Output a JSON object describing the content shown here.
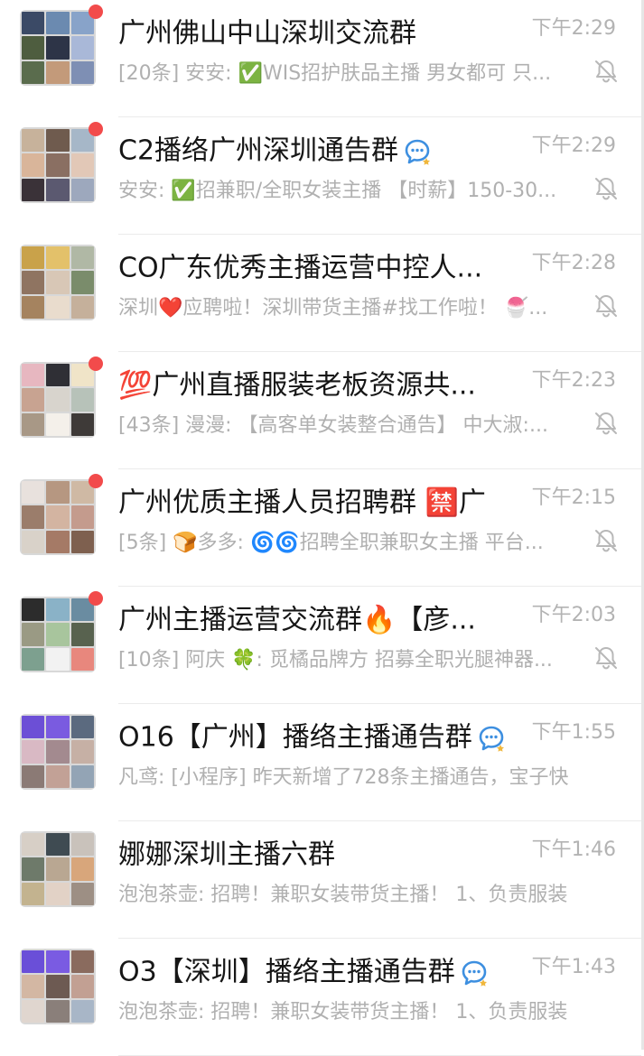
{
  "chats": [
    {
      "title": "广州佛山中山深圳交流群",
      "time": "下午2:29",
      "preview": "[20条] 安安: ✅WIS招护肤品主播 男女都可 只...",
      "unread_dot": true,
      "muted": true,
      "ai_badge": false,
      "tiles": [
        "#3b4a66",
        "#6b8ab0",
        "#88a3c9",
        "#4e5d3f",
        "#2d3447",
        "#a9b8d8",
        "#5a6c4d",
        "#c39a7a",
        "#7e8fb4"
      ]
    },
    {
      "title": "C2播络广州深圳通告群",
      "time": "下午2:29",
      "preview": "安安: ✅招兼职/全职女装主播 【时薪】150-30...",
      "unread_dot": true,
      "muted": true,
      "ai_badge": true,
      "tiles": [
        "#c7b29b",
        "#6f5b4e",
        "#a6b7c8",
        "#d9b59a",
        "#8a6f62",
        "#e2c8b7",
        "#3a3238",
        "#5b5970",
        "#9da8bd"
      ]
    },
    {
      "title": "CO广东优秀主播运营中控人...",
      "time": "下午2:28",
      "preview": "深圳❤️应聘啦！深圳带货主播#找工作啦！ 🍧...",
      "unread_dot": false,
      "muted": true,
      "ai_badge": false,
      "tiles": [
        "#c9a24a",
        "#e3c16a",
        "#b0b8a5",
        "#8f7461",
        "#d8c7b6",
        "#7a8c6b",
        "#a5835f",
        "#e9dccd",
        "#c5b09b"
      ]
    },
    {
      "title": "💯广州直播服装老板资源共...",
      "time": "下午2:23",
      "preview": "[43条] 漫漫: 【高客单女装整合通告】 中大淑:...",
      "unread_dot": true,
      "muted": true,
      "ai_badge": false,
      "tiles": [
        "#e7b7c0",
        "#2f2f35",
        "#f0e4c8",
        "#c8a391",
        "#d8d4cd",
        "#b7c2b9",
        "#a89886",
        "#f4f0ea",
        "#3e3a38"
      ]
    },
    {
      "title": "广州优质主播人员招聘群 🈲广",
      "time": "下午2:15",
      "preview": "[5条] 🍞多多: 🌀🌀招聘全职兼职女主播 平台...",
      "unread_dot": true,
      "muted": true,
      "ai_badge": false,
      "tiles": [
        "#e8e1dd",
        "#b69781",
        "#cfb9a4",
        "#9b7d6b",
        "#d3b4a1",
        "#c49b8d",
        "#d9d2c9",
        "#a57a66",
        "#7e604f"
      ]
    },
    {
      "title": "广州主播运营交流群🔥【彦...",
      "time": "下午2:03",
      "preview": "[10条] 阿庆 🍀: 觅橘品牌方 招募全职光腿神器...",
      "unread_dot": true,
      "muted": true,
      "ai_badge": false,
      "tiles": [
        "#2c2c2c",
        "#8ab2c7",
        "#6a8ca1",
        "#9a9a84",
        "#a8c59d",
        "#58624f",
        "#7da08f",
        "#f2f2f2",
        "#e8877d"
      ]
    },
    {
      "title": "O16【广州】播络主播通告群",
      "time": "下午1:55",
      "preview": "凡鸢: [小程序] 昨天新增了728条主播通告，宝子快...",
      "unread_dot": false,
      "muted": false,
      "ai_badge": true,
      "tiles": [
        "#6c4fd6",
        "#7a5be0",
        "#5b6a7f",
        "#d9b9c4",
        "#a38a8f",
        "#c6b0a5",
        "#8b7a75",
        "#c2a196",
        "#93a4b5"
      ]
    },
    {
      "title": "娜娜深圳主播六群",
      "time": "下午1:46",
      "preview": "泡泡茶壶: 招聘！兼职女装带货主播！ 1、负责服装...",
      "unread_dot": false,
      "muted": false,
      "ai_badge": false,
      "tiles": [
        "#d7cfc6",
        "#3f4b52",
        "#c9c2bb",
        "#6e7a6a",
        "#b9a792",
        "#d8a67b",
        "#c3b38f",
        "#e2d2c6",
        "#9d8f84"
      ]
    },
    {
      "title": "O3【深圳】播络主播通告群",
      "time": "下午1:43",
      "preview": "泡泡茶壶: 招聘！兼职女装带货主播！ 1、负责服装...",
      "unread_dot": false,
      "muted": false,
      "ai_badge": true,
      "tiles": [
        "#6a4fd8",
        "#7a5be2",
        "#8a6b5e",
        "#d3b7a3",
        "#6d5a52",
        "#c2a093",
        "#e0d6cf",
        "#8a7f7a",
        "#a8b6c7"
      ]
    }
  ]
}
